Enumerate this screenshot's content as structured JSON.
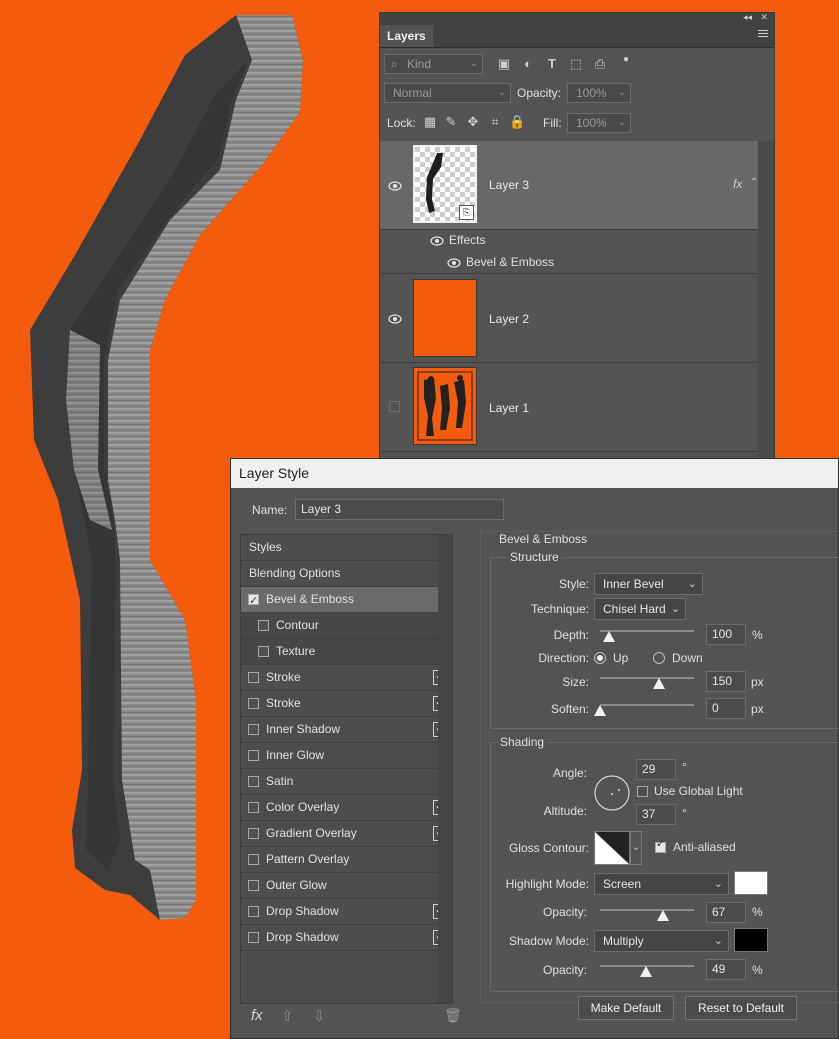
{
  "colors": {
    "canvas_background": "#f55b0c",
    "panel_background": "#535353",
    "highlight_swatch": "#ffffff",
    "shadow_swatch": "#000000"
  },
  "layers_panel": {
    "tab_label": "Layers",
    "filter_kind": "Kind",
    "blend_mode": "Normal",
    "opacity_label": "Opacity:",
    "opacity_value": "100%",
    "lock_label": "Lock:",
    "fill_label": "Fill:",
    "fill_value": "100%",
    "layers": [
      {
        "name": "Layer 3",
        "visible": true,
        "selected": true,
        "fx_label": "fx"
      },
      {
        "name": "Layer 2",
        "visible": true,
        "selected": false
      },
      {
        "name": "Layer 1",
        "visible": false,
        "selected": false
      }
    ],
    "effects_label": "Effects",
    "effect_items": [
      "Bevel & Emboss"
    ]
  },
  "layer_style": {
    "title": "Layer Style",
    "name_label": "Name:",
    "name_value": "Layer 3",
    "styles": [
      {
        "label": "Styles",
        "type": "header"
      },
      {
        "label": "Blending Options",
        "type": "header"
      },
      {
        "label": "Bevel & Emboss",
        "checked": true,
        "active": true
      },
      {
        "label": "Contour",
        "checked": false,
        "sub": true
      },
      {
        "label": "Texture",
        "checked": false,
        "sub": true
      },
      {
        "label": "Stroke",
        "checked": false,
        "plus": true
      },
      {
        "label": "Stroke",
        "checked": false,
        "plus": true
      },
      {
        "label": "Inner Shadow",
        "checked": false,
        "plus": true
      },
      {
        "label": "Inner Glow",
        "checked": false
      },
      {
        "label": "Satin",
        "checked": false
      },
      {
        "label": "Color Overlay",
        "checked": false,
        "plus": true
      },
      {
        "label": "Gradient Overlay",
        "checked": false,
        "plus": true
      },
      {
        "label": "Pattern Overlay",
        "checked": false
      },
      {
        "label": "Outer Glow",
        "checked": false
      },
      {
        "label": "Drop Shadow",
        "checked": false,
        "plus": true
      },
      {
        "label": "Drop Shadow",
        "checked": false,
        "plus": true
      }
    ],
    "section_title": "Bevel & Emboss",
    "structure": {
      "title": "Structure",
      "style_label": "Style:",
      "style_value": "Inner Bevel",
      "technique_label": "Technique:",
      "technique_value": "Chisel Hard",
      "depth_label": "Depth:",
      "depth_value": "100",
      "depth_unit": "%",
      "direction_label": "Direction:",
      "direction_up": "Up",
      "direction_down": "Down",
      "size_label": "Size:",
      "size_value": "150",
      "size_unit": "px",
      "soften_label": "Soften:",
      "soften_value": "0",
      "soften_unit": "px"
    },
    "shading": {
      "title": "Shading",
      "angle_label": "Angle:",
      "angle_value": "29",
      "degree": "°",
      "use_global_light": "Use Global Light",
      "altitude_label": "Altitude:",
      "altitude_value": "37",
      "gloss_contour_label": "Gloss Contour:",
      "anti_aliased": "Anti-aliased",
      "highlight_mode_label": "Highlight Mode:",
      "highlight_mode_value": "Screen",
      "highlight_opacity_label": "Opacity:",
      "highlight_opacity_value": "67",
      "shadow_mode_label": "Shadow Mode:",
      "shadow_mode_value": "Multiply",
      "shadow_opacity_label": "Opacity:",
      "shadow_opacity_value": "49",
      "percent": "%"
    },
    "slider_levels": {
      "depth": 0.1,
      "size": 0.63,
      "soften": 0.0,
      "highlight_opacity": 0.67,
      "shadow_opacity": 0.49
    },
    "make_default": "Make Default",
    "reset_default": "Reset to Default"
  }
}
